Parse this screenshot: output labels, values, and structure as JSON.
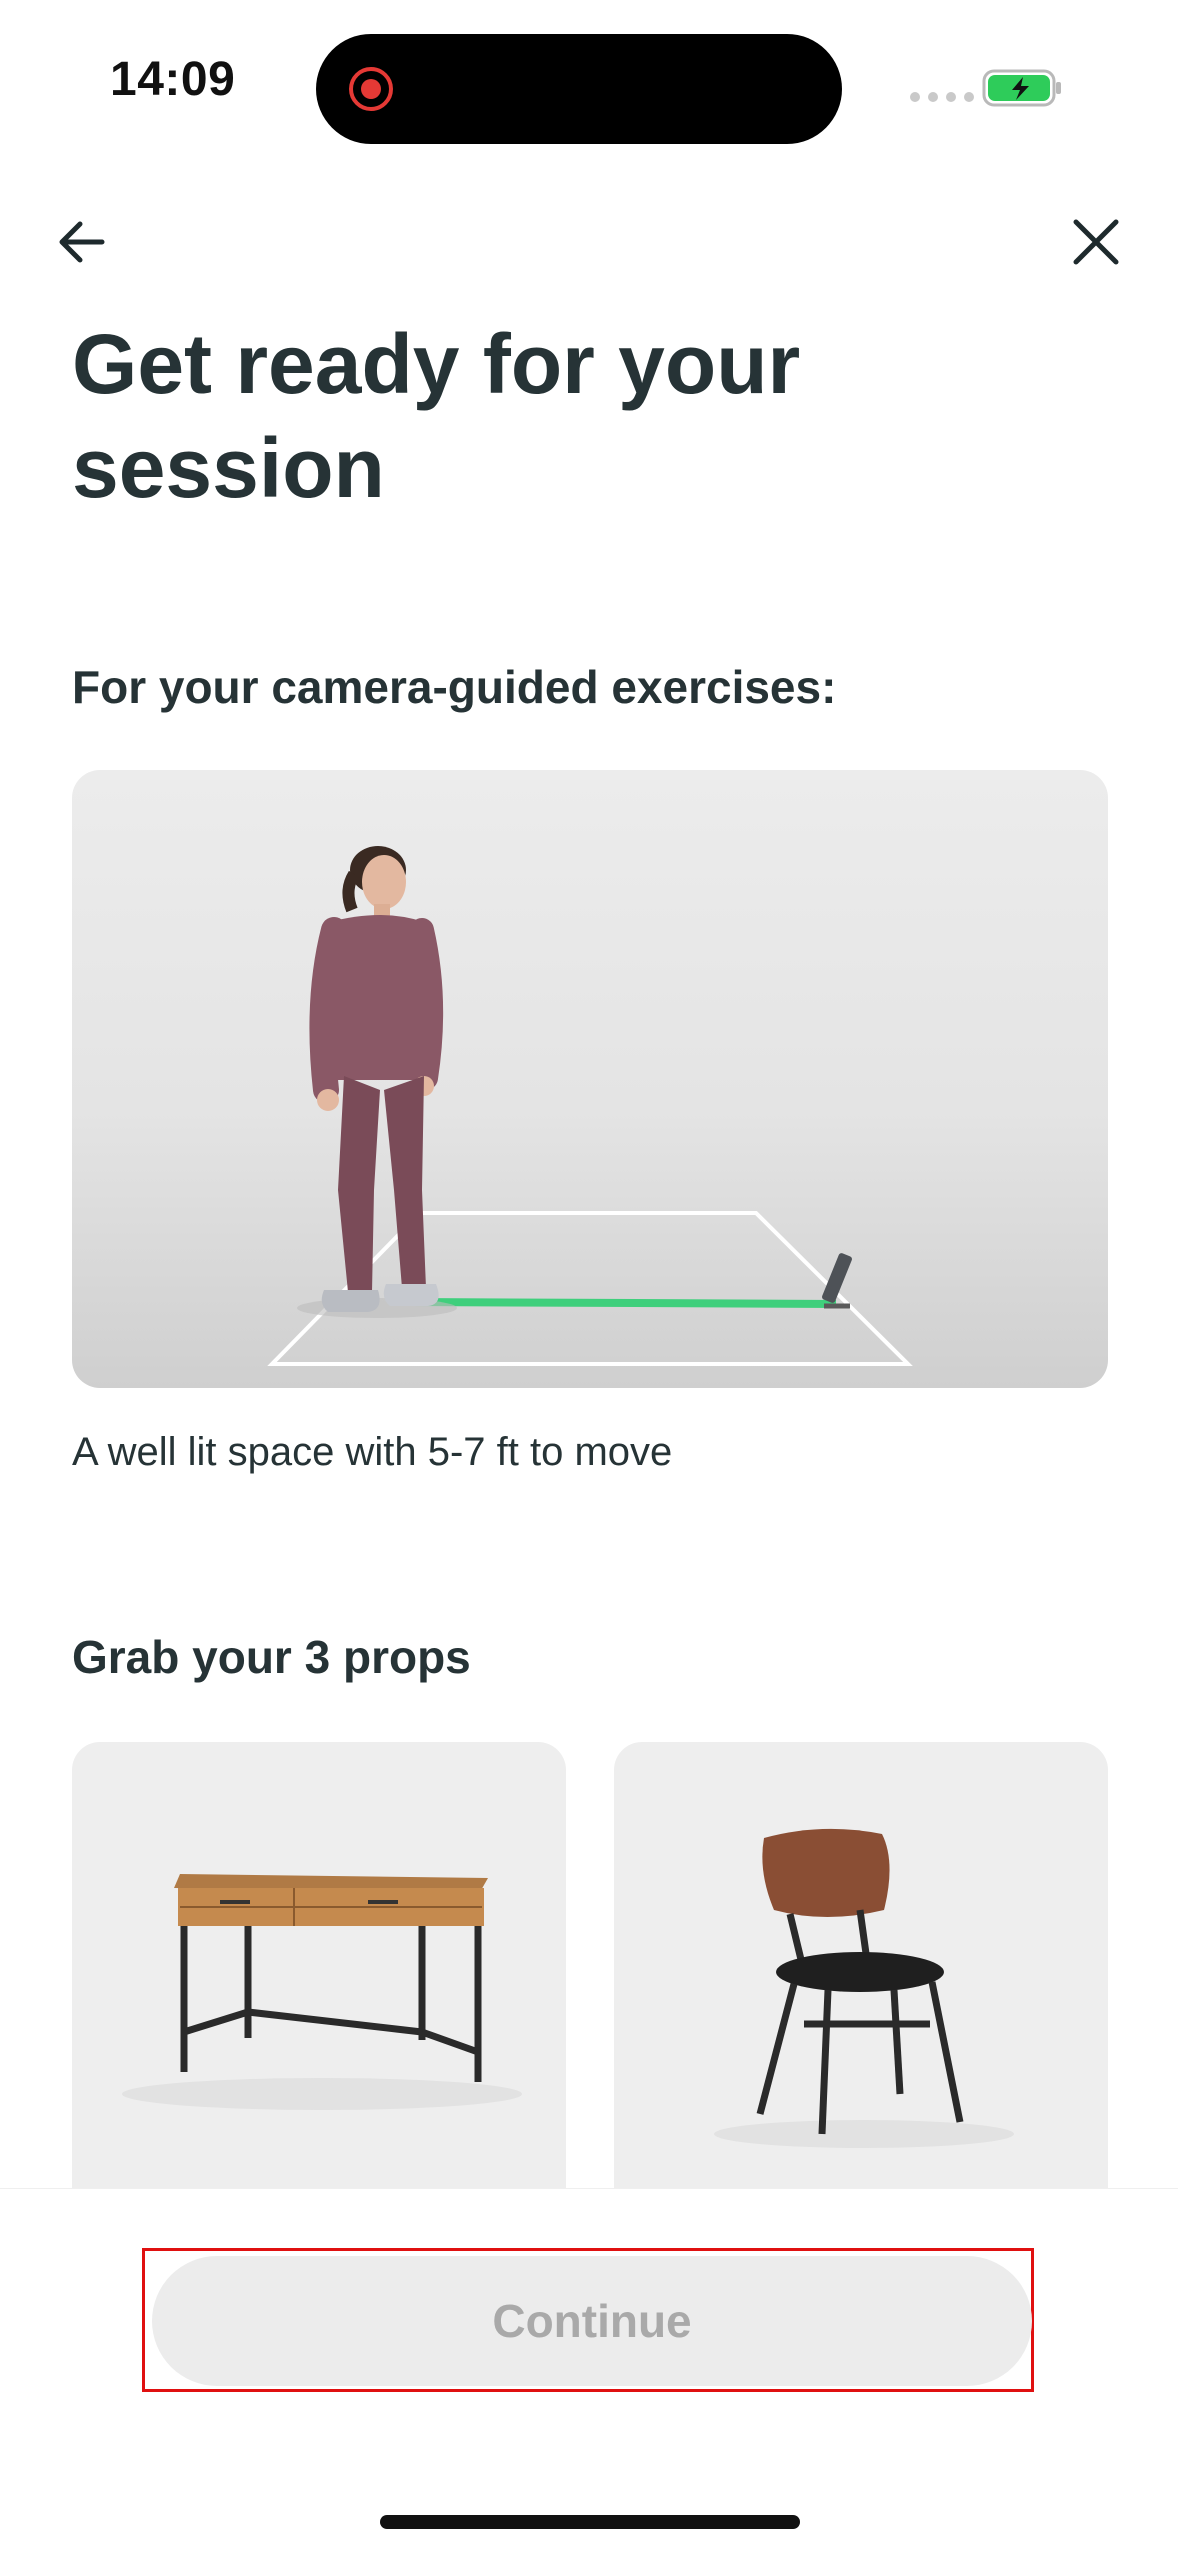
{
  "status_bar": {
    "time": "14:09",
    "battery_icon": "battery-charging-icon",
    "recording_icon": "screen-recording-icon",
    "colors": {
      "battery": "#2ecc5a",
      "recording": "#e53935"
    }
  },
  "nav": {
    "back_icon": "arrow-left-icon",
    "close_icon": "close-icon"
  },
  "page": {
    "title": "Get ready for your session"
  },
  "camera_section": {
    "heading": "For your camera-guided exercises:",
    "caption": "A well lit space with 5-7 ft to move",
    "image": "person-standing-in-floor-area-with-phone",
    "accent_color": "#3fcf7c"
  },
  "props_section": {
    "heading": "Grab your 3 props",
    "items": [
      {
        "image": "desk"
      },
      {
        "image": "chair"
      }
    ]
  },
  "footer": {
    "continue_label": "Continue",
    "continue_enabled": false
  }
}
